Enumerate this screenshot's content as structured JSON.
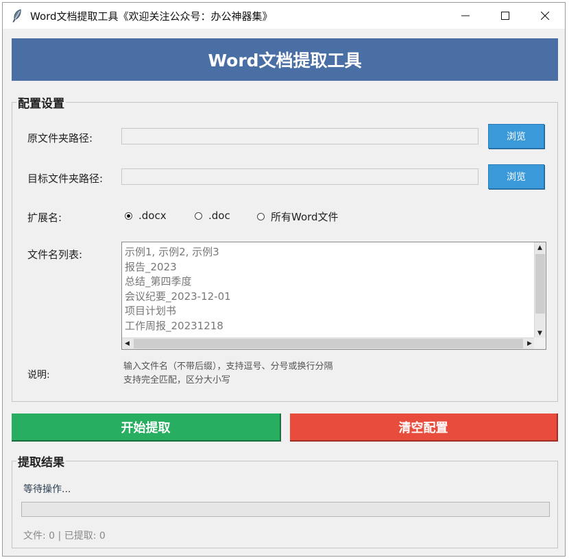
{
  "window": {
    "title": "Word文档提取工具《欢迎关注公众号：办公神器集》"
  },
  "banner": {
    "title": "Word文档提取工具"
  },
  "config": {
    "legend": "配置设置",
    "source_label": "原文件夹路径:",
    "source_value": "",
    "target_label": "目标文件夹路径:",
    "target_value": "",
    "browse_label": "浏览",
    "ext_label": "扩展名:",
    "ext_options": [
      ".docx",
      ".doc",
      "所有Word文件"
    ],
    "ext_selected": ".docx",
    "filelist_label": "文件名列表:",
    "filelist_lines": [
      "示例1, 示例2, 示例3",
      "报告_2023",
      "总结_第四季度",
      "会议纪要_2023-12-01",
      "项目计划书",
      "工作周报_20231218"
    ],
    "note_label": "说明:",
    "note_lines": [
      "输入文件名（不带后缀），支持逗号、分号或换行分隔",
      "支持完全匹配，区分大小写"
    ]
  },
  "actions": {
    "start_label": "开始提取",
    "clear_label": "清空配置",
    "start_color": "#27ae60",
    "clear_color": "#e74c3c"
  },
  "result": {
    "legend": "提取结果",
    "status": "等待操作...",
    "progress_fraction": 0,
    "stats": "文件: 0 | 已提取: 0"
  }
}
